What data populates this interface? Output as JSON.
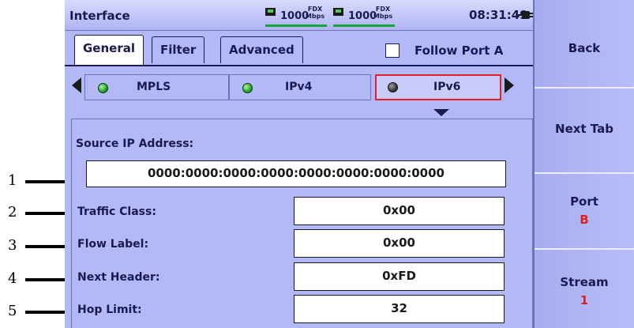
{
  "header": {
    "title": "Interface",
    "port_a": {
      "rate": "1000",
      "duplex_top": "FDX",
      "duplex_bottom": "Mbps"
    },
    "port_b": {
      "rate": "1000",
      "duplex_top": "FDX",
      "duplex_bottom": "Mbps"
    },
    "clock": "08:31:49"
  },
  "tabs": [
    "General",
    "Filter",
    "Advanced"
  ],
  "follow_port": {
    "label": "Follow Port A",
    "checked": false
  },
  "subtabs": [
    {
      "label": "MPLS",
      "led": "on"
    },
    {
      "label": "IPv4",
      "led": "on"
    },
    {
      "label": "IPv6",
      "led": "off",
      "selected": true
    }
  ],
  "fields": {
    "source_ip_label": "Source IP Address:",
    "source_ip_value": "0000:0000:0000:0000:0000:0000:0000:0000",
    "traffic_class_label": "Traffic Class:",
    "traffic_class_value": "0x00",
    "flow_label_label": "Flow Label:",
    "flow_label_value": "0x00",
    "next_header_label": "Next Header:",
    "next_header_value": "0xFD",
    "hop_limit_label": "Hop Limit:",
    "hop_limit_value": "32"
  },
  "sidebar": {
    "back": "Back",
    "next_tab": "Next Tab",
    "port_label": "Port",
    "port_value": "B",
    "stream_label": "Stream",
    "stream_value": "1"
  },
  "callouts": [
    "1",
    "2",
    "3",
    "4",
    "5"
  ],
  "colors": {
    "background": "#b3b8f6",
    "link_bar": "#10a63a",
    "selected_border": "#e51f2a",
    "accent_value": "#e01f1f"
  }
}
